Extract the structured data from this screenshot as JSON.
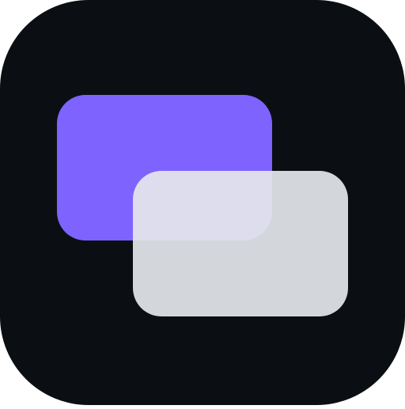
{
  "icon": {
    "name": "overlapping-windows-app-icon",
    "colors": {
      "background": "#0b0f14",
      "back_card": "#7f63ff",
      "front_card": "#e5e7eb",
      "front_card_opacity": 0.92
    }
  }
}
